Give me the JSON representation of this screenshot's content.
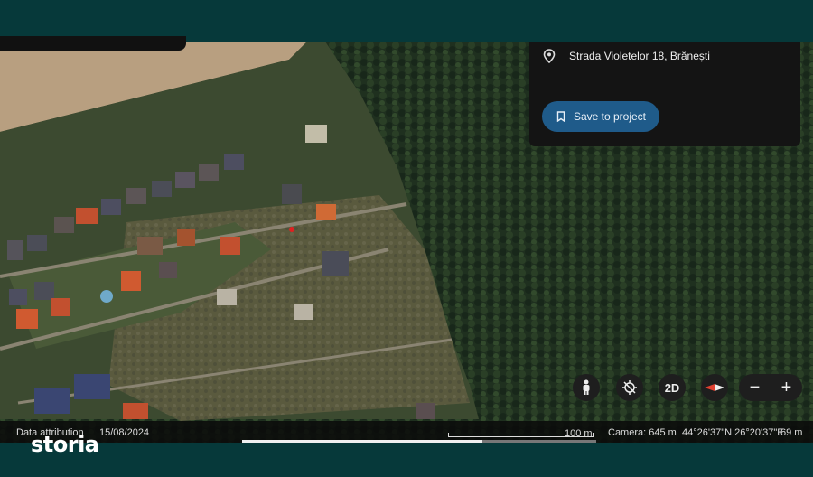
{
  "address": {
    "text": "Strada Violetelor 18, Brănești"
  },
  "actions": {
    "save_label": "Save to project"
  },
  "controls": {
    "view_mode_label": "2D",
    "zoom_out": "−",
    "zoom_in": "+"
  },
  "status": {
    "attribution": "Data attribution",
    "date": "15/08/2024",
    "scale": "100 m",
    "camera": "Camera: 645 m",
    "coordinates": "44°26'37\"N 26°20'37\"E",
    "elevation": "69 m"
  },
  "brand": {
    "logo_text": "storia"
  },
  "colors": {
    "frame": "#06393a",
    "forest": "#1f2f1f",
    "field": "#b89f80",
    "button": "#1f5b8a"
  },
  "icons": {
    "location": "location-pin-icon",
    "bookmark": "bookmark-icon",
    "street_view": "pegman-icon",
    "recenter": "location-off-icon",
    "compass": "compass-icon"
  }
}
